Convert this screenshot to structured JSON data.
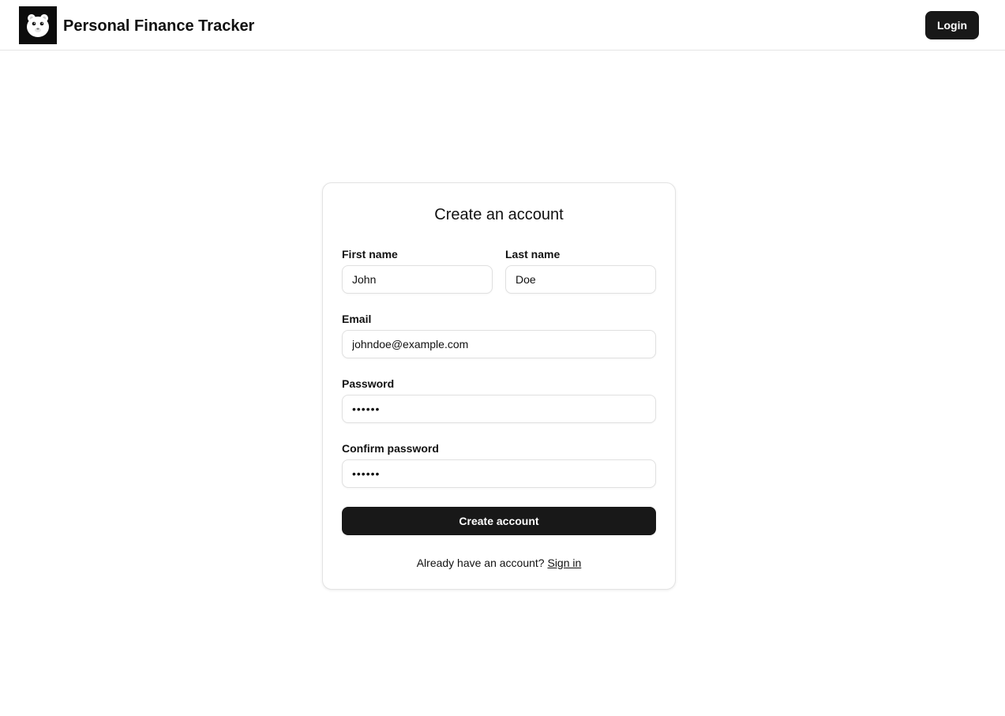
{
  "header": {
    "app_title": "Personal Finance Tracker",
    "logo_icon": "bear-face-icon",
    "login_label": "Login"
  },
  "form": {
    "title": "Create an account",
    "first_name": {
      "label": "First name",
      "value": "John"
    },
    "last_name": {
      "label": "Last name",
      "value": "Doe"
    },
    "email": {
      "label": "Email",
      "value": "johndoe@example.com"
    },
    "password": {
      "label": "Password",
      "value": "••••••"
    },
    "confirm_password": {
      "label": "Confirm password",
      "value": "••••••"
    },
    "submit_label": "Create account",
    "signin_prompt": "Already have an account?",
    "signin_link": "Sign in"
  },
  "colors": {
    "primary_button": "#181818",
    "border": "#e3e3e3",
    "text": "#111111"
  }
}
